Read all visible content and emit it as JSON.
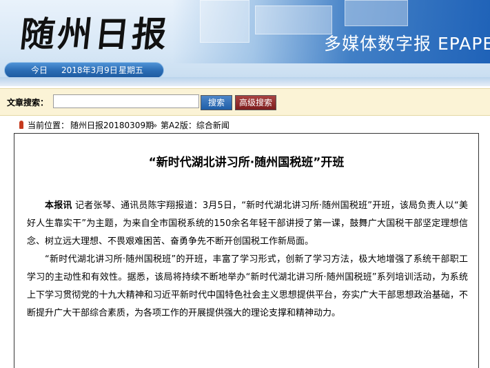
{
  "header": {
    "logo_text": "随州日报",
    "epaper_text": "多媒体数字报 EPAPE",
    "date_today_label": "今日",
    "date_value": "2018年3月9日",
    "weekday": "星期五",
    "banner_accent": "#2b6db5"
  },
  "search": {
    "label": "文章搜索：",
    "input_value": "",
    "search_button": "搜索",
    "advanced_button": "高级搜索"
  },
  "breadcrumb": {
    "prefix": "当前位置：",
    "paper": "随州日报20180309期",
    "separator": "»",
    "section": "第A2版：综合新闻"
  },
  "article": {
    "title": "“新时代湖北讲习所·随州国税班”开班",
    "lead": "本报讯",
    "para1": "记者张琴、通讯员陈宇翔报道：3月5日，“新时代湖北讲习所·随州国税班”开班，该局负责人以“美好人生靠实干”为主题，为来自全市国税系统的150余名年轻干部讲授了第一课，鼓舞广大国税干部坚定理想信念、树立远大理想、不畏艰难困苦、奋勇争先不断开创国税工作新局面。",
    "para2": "“新时代湖北讲习所·随州国税班”的开班，丰富了学习形式，创新了学习方法，极大地增强了系统干部职工学习的主动性和有效性。据悉，该局将持续不断地举办“新时代湖北讲习所·随州国税班”系列培训活动，为系统上下学习贯彻党的十九大精神和习近平新时代中国特色社会主义思想提供平台，夯实广大干部思想政治基础，不断提升广大干部综合素质，为各项工作的开展提供强大的理论支撑和精神动力。"
  }
}
